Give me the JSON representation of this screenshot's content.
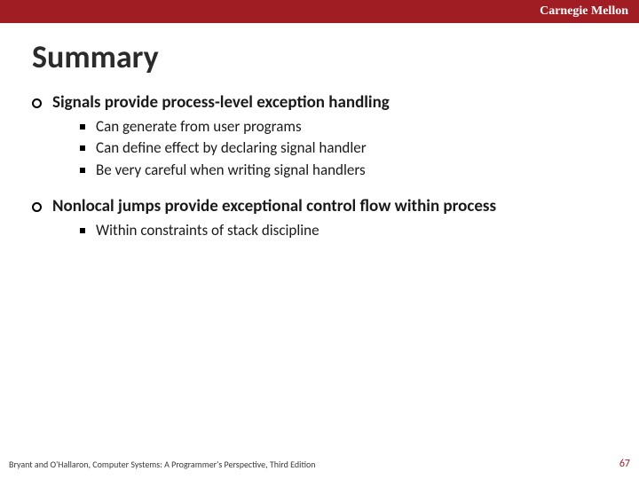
{
  "header": {
    "org": "Carnegie Mellon"
  },
  "title": "Summary",
  "points": [
    {
      "text": "Signals provide process-level exception handling",
      "subs": [
        "Can generate from user programs",
        "Can define effect by declaring signal handler",
        "Be very careful when writing signal handlers"
      ]
    },
    {
      "text": "Nonlocal jumps provide exceptional control flow within process",
      "subs": [
        "Within constraints of stack discipline"
      ]
    }
  ],
  "footer": {
    "citation": "Bryant and O'Hallaron, Computer Systems: A Programmer's Perspective, Third Edition",
    "page": "67"
  }
}
